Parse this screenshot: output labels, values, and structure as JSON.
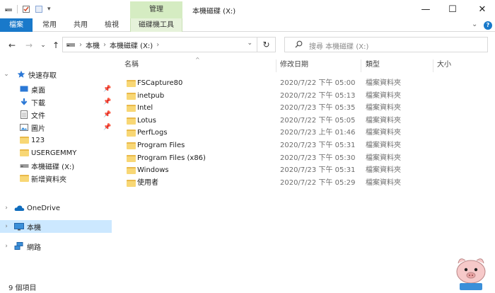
{
  "window": {
    "title": "本機磁碟 (X:)",
    "context_tab": "管理",
    "minimize": "—",
    "maximize": "☐",
    "close": "✕"
  },
  "ribbon": {
    "tabs": [
      "檔案",
      "常用",
      "共用",
      "檢視",
      "磁碟機工具"
    ],
    "expand_chevron": "⌄"
  },
  "address": {
    "back": "←",
    "forward": "→",
    "recent": "⌄",
    "up": "↑",
    "crumbs": [
      "本機",
      "本機磁碟 (X:)"
    ],
    "separator": "›",
    "refresh": "↻"
  },
  "search": {
    "placeholder": "搜尋 本機磁碟 (X:)"
  },
  "nav": {
    "quick_access": "快速存取",
    "quick_items": [
      {
        "label": "桌面",
        "icon": "desktop-icon",
        "pinned": true
      },
      {
        "label": "下載",
        "icon": "download-icon",
        "pinned": true
      },
      {
        "label": "文件",
        "icon": "documents-icon",
        "pinned": true
      },
      {
        "label": "圖片",
        "icon": "pictures-icon",
        "pinned": true
      },
      {
        "label": "123",
        "icon": "folder-icon",
        "pinned": false
      },
      {
        "label": "USERGEMMY",
        "icon": "folder-icon",
        "pinned": false
      },
      {
        "label": "本機磁碟 (X:)",
        "icon": "drive-icon",
        "pinned": false
      },
      {
        "label": "新增資料夾",
        "icon": "folder-icon",
        "pinned": false
      }
    ],
    "onedrive": "OneDrive",
    "this_pc": "本機",
    "network": "網路"
  },
  "columns": {
    "name": "名稱",
    "date": "修改日期",
    "type": "類型",
    "size": "大小"
  },
  "files": [
    {
      "name": "FSCapture80",
      "date": "2020/7/22 下午 05:00",
      "type": "檔案資料夾"
    },
    {
      "name": "inetpub",
      "date": "2020/7/22 下午 05:13",
      "type": "檔案資料夾"
    },
    {
      "name": "Intel",
      "date": "2020/7/23 下午 05:35",
      "type": "檔案資料夾"
    },
    {
      "name": "Lotus",
      "date": "2020/7/22 下午 05:05",
      "type": "檔案資料夾"
    },
    {
      "name": "PerfLogs",
      "date": "2020/7/23 上午 01:46",
      "type": "檔案資料夾"
    },
    {
      "name": "Program Files",
      "date": "2020/7/23 下午 05:31",
      "type": "檔案資料夾"
    },
    {
      "name": "Program Files (x86)",
      "date": "2020/7/23 下午 05:30",
      "type": "檔案資料夾"
    },
    {
      "name": "Windows",
      "date": "2020/7/23 下午 05:31",
      "type": "檔案資料夾"
    },
    {
      "name": "使用者",
      "date": "2020/7/22 下午 05:29",
      "type": "檔案資料夾"
    }
  ],
  "status": {
    "count": "9 個項目"
  },
  "colors": {
    "file_tab": "#1979ca",
    "context_tab": "#d5ecc2",
    "selection": "#cce8ff",
    "folder": "#f8d775"
  }
}
